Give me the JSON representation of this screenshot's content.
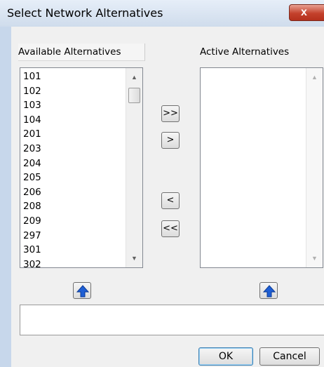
{
  "window": {
    "title": "Select Network Alternatives",
    "close_glyph": "x"
  },
  "available": {
    "label": "Available Alternatives",
    "items": [
      "101",
      "102",
      "103",
      "104",
      "201",
      "203",
      "204",
      "205",
      "206",
      "208",
      "209",
      "297",
      "301",
      "302"
    ]
  },
  "active": {
    "label": "Active Alternatives",
    "items": []
  },
  "move_buttons": {
    "add_all": ">>",
    "add": ">",
    "remove": "<",
    "remove_all": "<<"
  },
  "message": "",
  "dialog_buttons": {
    "ok": "OK",
    "cancel": "Cancel"
  },
  "icons": {
    "sort_up": "blue-up-arrow-icon"
  },
  "colors": {
    "sort_arrow": "#1f5fd4",
    "title_bg": "#cfdcec",
    "close_bg": "#c4412c"
  }
}
